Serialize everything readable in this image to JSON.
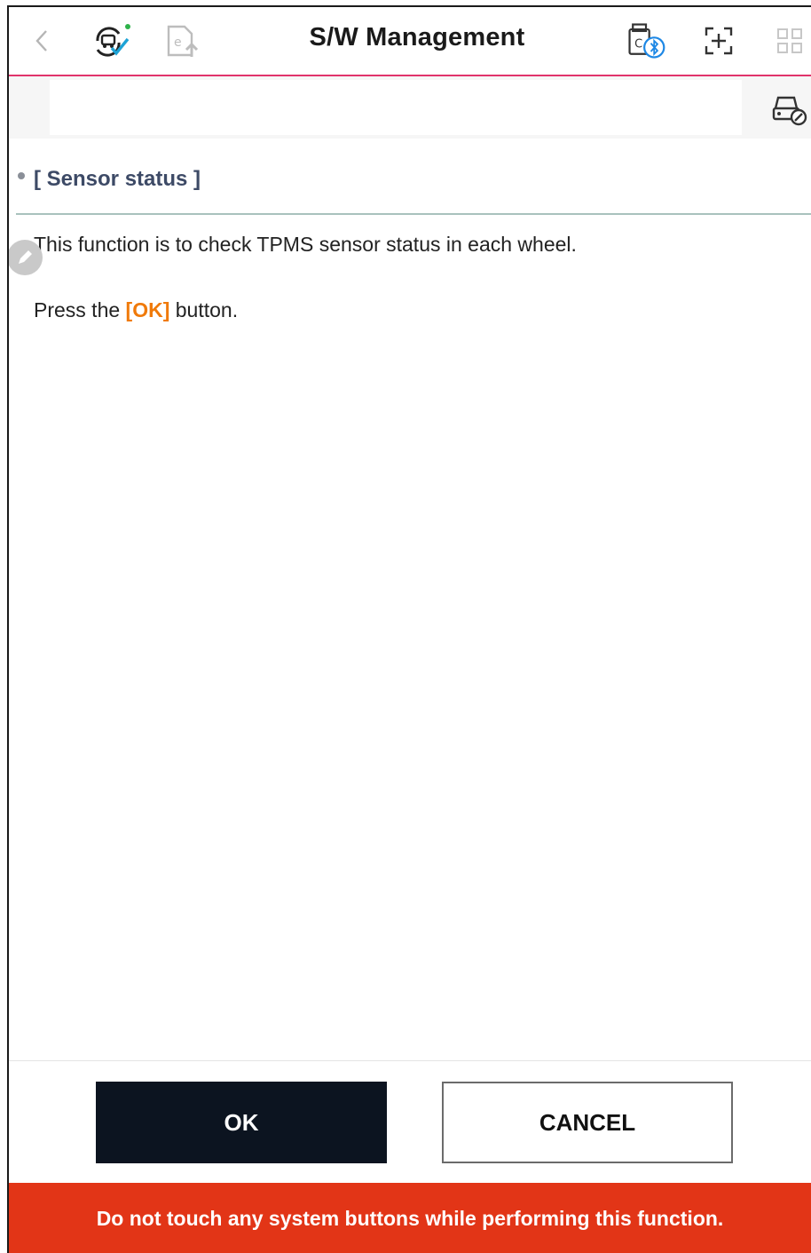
{
  "header": {
    "title": "S/W Management",
    "icons": [
      "back-icon",
      "vehicle-sync-icon",
      "file-upload-icon",
      "vci-bluetooth-icon",
      "capture-icon",
      "grid-menu-icon"
    ]
  },
  "subbar": {
    "icons": [
      "vehicle-check-icon"
    ]
  },
  "section": {
    "title": "[ Sensor status ]",
    "line1": "This function is to check TPMS sensor status in each wheel.",
    "line2_prefix": "Press the ",
    "line2_highlight": "[OK]",
    "line2_suffix": " button."
  },
  "buttons": {
    "ok": "OK",
    "cancel": "CANCEL"
  },
  "warning": "Do not touch any system buttons while performing this function.",
  "colors": {
    "accent_line": "#e0336b",
    "highlight": "#f07a0a",
    "warning_bg": "#e23517",
    "ok_bg": "#0c1420"
  }
}
